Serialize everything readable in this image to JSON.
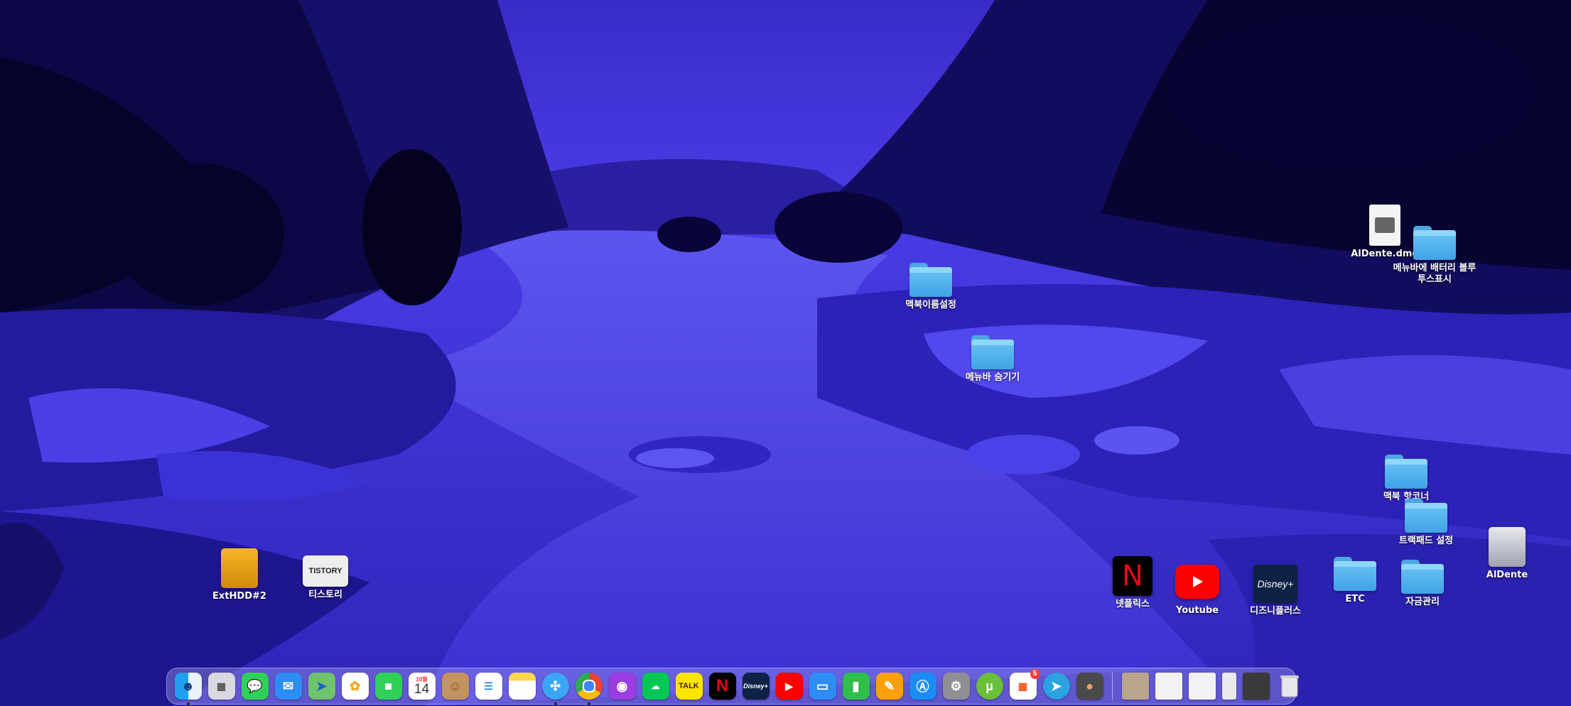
{
  "desktop": {
    "items": {
      "macbook_name_settings": "맥북이름설정",
      "hide_menubar": "메뉴바 숨기기",
      "aldente_dmg": "AlDente.dmg",
      "menubar_battery": "메뉴바에 배터리 블루투스표시",
      "macbook_hotcorner": "맥북 핫코너",
      "trackpad_settings": "트랙패드 설정",
      "aldente": "AlDente",
      "finance": "자금관리",
      "etc": "ETC",
      "disney_plus": "디즈니플러스",
      "youtube": "Youtube",
      "netflix": "넷플릭스",
      "tistory": "티스토리",
      "exthdd": "ExtHDD#2"
    },
    "thumb_text": {
      "tistory": "TISTORY",
      "netflix": "N",
      "disney": "Disney+"
    }
  },
  "dock": {
    "calendar_month": "10월",
    "calendar_day": "14",
    "app_store_badge": "5",
    "icons": {
      "talk": "TALK",
      "netflix": "N",
      "disney": "Disney+"
    }
  }
}
